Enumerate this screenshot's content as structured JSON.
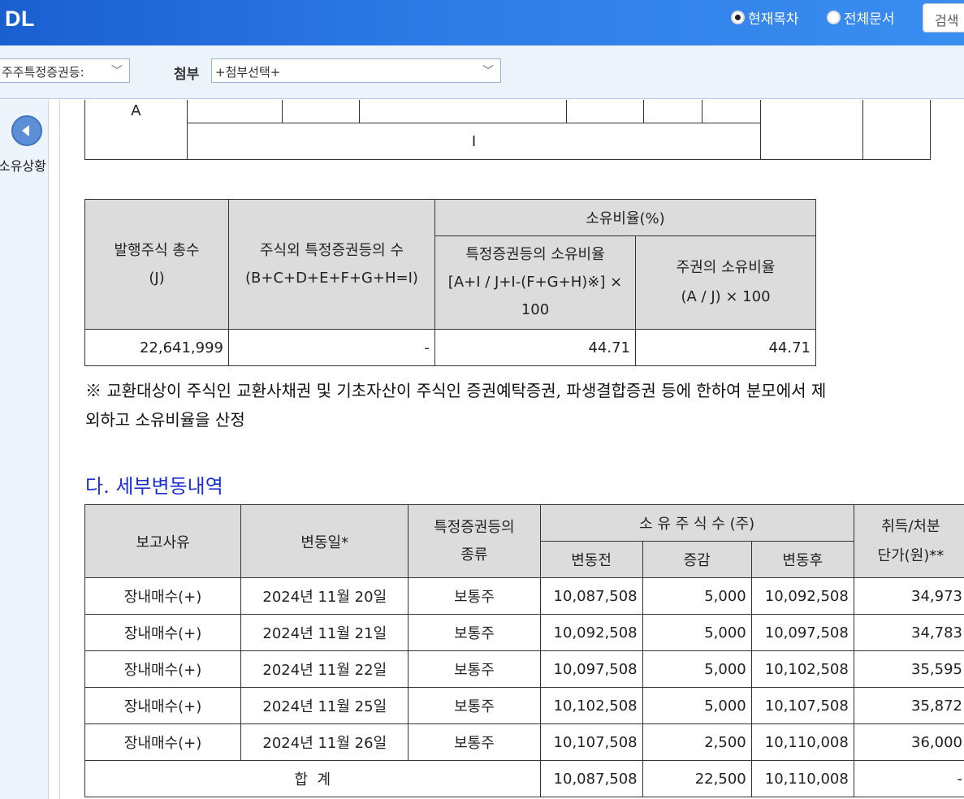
{
  "header": {
    "logo": "DL",
    "radio_current": "현재목차",
    "radio_all": "전체문서",
    "search_label": "검색"
  },
  "toolbar": {
    "doc_select_value": "주주특정증권등:",
    "attach_label": "첨부",
    "attach_select_value": "+첨부선택+"
  },
  "sidebar": {
    "tree_label": "소유상황"
  },
  "top_fragment": {
    "row_label_a": "A",
    "row_label_i": "I"
  },
  "ratio_table": {
    "headers": {
      "issued": "발행주식 총수",
      "issued_sub": "(J)",
      "other_count": "주식외 특정증권등의 수",
      "other_count_sub": "(B+C+D+E+F+G+H=I)",
      "ratio_group": "소유비율(%)",
      "specific_ratio": "특정증권등의 소유비율",
      "specific_ratio_formula": "[A+I / J+I-(F+G+H)※] ×",
      "specific_ratio_formula2": "100",
      "share_ratio": "주권의 소유비율",
      "share_ratio_formula": "(A / J) × 100"
    },
    "row": {
      "issued": "22,641,999",
      "other_count": "-",
      "specific_ratio": "44.71",
      "share_ratio": "44.71"
    }
  },
  "note_text": "※ 교환대상이 주식인 교환사채권 및 기초자산이 주식인 증권예탁증권, 파생결합증권 등에 한하여 분모에서 제외하고 소유비율을 산정",
  "section_title": "다. 세부변동내역",
  "detail_table": {
    "headers": {
      "reason": "보고사유",
      "date": "변동일*",
      "type_line1": "특정증권등의",
      "type_line2": "종류",
      "shares_group": "소 유 주 식 수 (주)",
      "before": "변동전",
      "change": "증감",
      "after": "변동후",
      "price_line1": "취득/처분",
      "price_line2": "단가(원)**"
    },
    "rows": [
      {
        "reason": "장내매수(+)",
        "date": "2024년 11월 20일",
        "type": "보통주",
        "before": "10,087,508",
        "change": "5,000",
        "after": "10,092,508",
        "price": "34,973"
      },
      {
        "reason": "장내매수(+)",
        "date": "2024년 11월 21일",
        "type": "보통주",
        "before": "10,092,508",
        "change": "5,000",
        "after": "10,097,508",
        "price": "34,783"
      },
      {
        "reason": "장내매수(+)",
        "date": "2024년 11월 22일",
        "type": "보통주",
        "before": "10,097,508",
        "change": "5,000",
        "after": "10,102,508",
        "price": "35,595"
      },
      {
        "reason": "장내매수(+)",
        "date": "2024년 11월 25일",
        "type": "보통주",
        "before": "10,102,508",
        "change": "5,000",
        "after": "10,107,508",
        "price": "35,872"
      },
      {
        "reason": "장내매수(+)",
        "date": "2024년 11월 26일",
        "type": "보통주",
        "before": "10,107,508",
        "change": "2,500",
        "after": "10,110,008",
        "price": "36,000"
      }
    ],
    "total": {
      "label": "합  계",
      "before": "10,087,508",
      "change": "22,500",
      "after": "10,110,008",
      "price": "-"
    }
  }
}
